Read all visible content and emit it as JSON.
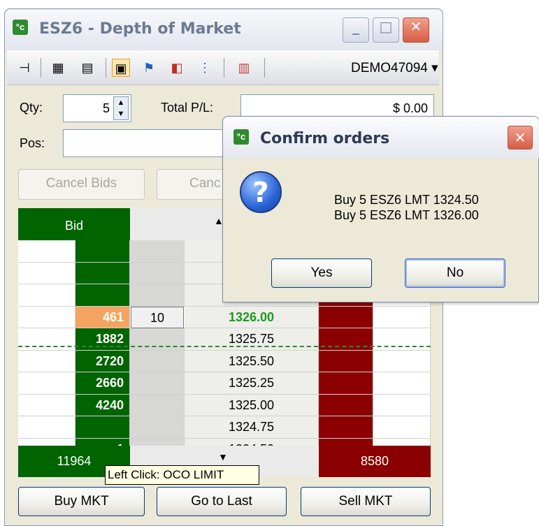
{
  "window": {
    "app_icon": "°c",
    "title": "ESZ6 - Depth of Market",
    "icons": {
      "minimize": "minimize-icon",
      "maximize": "maximize-icon",
      "close": "close-icon"
    }
  },
  "toolbar": {
    "icons": [
      "pin-icon",
      "calculator-icon",
      "properties-icon",
      "dom-settings-icon",
      "flag-icon",
      "bracket-order-icon",
      "ladder-center-icon",
      "chart-icon"
    ],
    "account": "DEMO47094 ▾"
  },
  "form": {
    "qty_label": "Qty:",
    "qty_value": "5",
    "total_pl_label": "Total P/L:",
    "total_pl_value": "$ 0.00",
    "pos_label": "Pos:",
    "pos_value": "0"
  },
  "buttons": {
    "cancel_bids": "Cancel Bids",
    "cancel_asks": "Canc",
    "buy_mkt": "Buy MKT",
    "go_to_last": "Go to Last",
    "sell_mkt": "Sell MKT"
  },
  "ladder": {
    "bid_header": "Bid",
    "sort_up": "▲",
    "sort_down": "▼",
    "rows": [
      {
        "bid": "",
        "qty": "",
        "price": ""
      },
      {
        "bid": "",
        "qty": "",
        "price": ""
      },
      {
        "bid": "",
        "qty": "",
        "price": ""
      },
      {
        "bid": "461",
        "qty": "10",
        "price": "1326.00"
      },
      {
        "bid": "1882",
        "qty": "",
        "price": "1325.75"
      },
      {
        "bid": "2720",
        "qty": "",
        "price": "1325.50"
      },
      {
        "bid": "2660",
        "qty": "",
        "price": "1325.25"
      },
      {
        "bid": "4240",
        "qty": "",
        "price": "1325.00"
      },
      {
        "bid": "",
        "qty": "",
        "price": "1324.75"
      },
      {
        "bid": "1",
        "qty": "",
        "price": "1324.50"
      }
    ],
    "bid_total": "11964",
    "ask_total": "8580"
  },
  "tooltip": "Left Click: OCO LIMIT",
  "dialog": {
    "icon": "°c",
    "title": "Confirm orders",
    "line1": "Buy 5 ESZ6 LMT 1324.50",
    "line2": "Buy 5 ESZ6 LMT 1326.00",
    "question_glyph": "?",
    "yes": "Yes",
    "no": "No"
  },
  "colors": {
    "bid": "#006400",
    "ask": "#8b0000",
    "highlight_bid": "#f4a460",
    "last_price": "#1f9a1f"
  }
}
